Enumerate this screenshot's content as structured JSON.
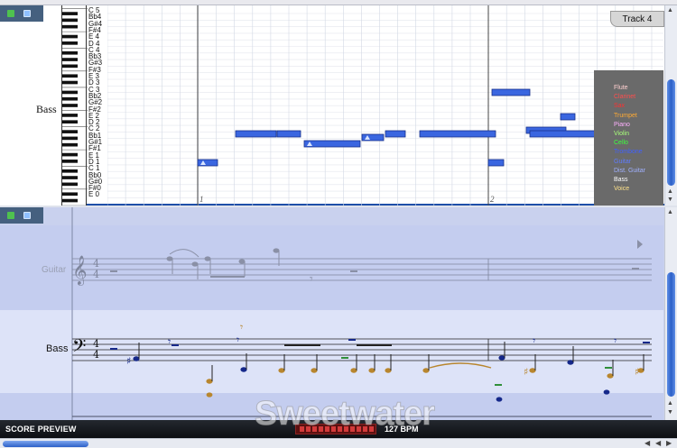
{
  "roll": {
    "track_tab": "Track 4",
    "track_name": "Bass",
    "note_names": [
      "C 5",
      "Bb4",
      "G#4",
      "F#4",
      "E 4",
      "D 4",
      "C 4",
      "Bb3",
      "G#3",
      "F#3",
      "E 3",
      "D 3",
      "C 3",
      "Bb2",
      "G#2",
      "F#2",
      "E 2",
      "D 2",
      "C 2",
      "Bb1",
      "G#1",
      "F#1",
      "E 1",
      "D 1",
      "C 1",
      "Bb0",
      "G#0",
      "F#0",
      "E 0"
    ],
    "measures": [
      "1",
      "2"
    ],
    "legend": [
      {
        "label": "Flute",
        "color": "#ffd0d0"
      },
      {
        "label": "Clarinet",
        "color": "#ff4d4d"
      },
      {
        "label": "Sax",
        "color": "#ff3030"
      },
      {
        "label": "Trumpet",
        "color": "#ffaa33"
      },
      {
        "label": "Piano",
        "color": "#ffb0ff"
      },
      {
        "label": "Violin",
        "color": "#a8ff7a"
      },
      {
        "label": "Cello",
        "color": "#3dff3d"
      },
      {
        "label": "Trombone",
        "color": "#4060ff"
      },
      {
        "label": "Guitar",
        "color": "#5e7bff"
      },
      {
        "label": "Dist. Guitar",
        "color": "#9fb0ff"
      },
      {
        "label": "Bass",
        "color": "#ffffff"
      },
      {
        "label": "Voice",
        "color": "#ffe38a"
      }
    ]
  },
  "score": {
    "guitar_label": "Guitar",
    "bass_label": "Bass",
    "time_signature": {
      "top": "4",
      "bottom": "4"
    }
  },
  "bottom_bar": {
    "title": "SCORE PREVIEW",
    "bpm": "127 BPM",
    "watermark": "Sweetwater"
  },
  "colors": {
    "note_fill": "#3a66e0",
    "panel_header": "#45607f",
    "guitar_band": "#c4cdef",
    "bass_band": "#dde3f8",
    "bottom_bar": "#15181d"
  }
}
